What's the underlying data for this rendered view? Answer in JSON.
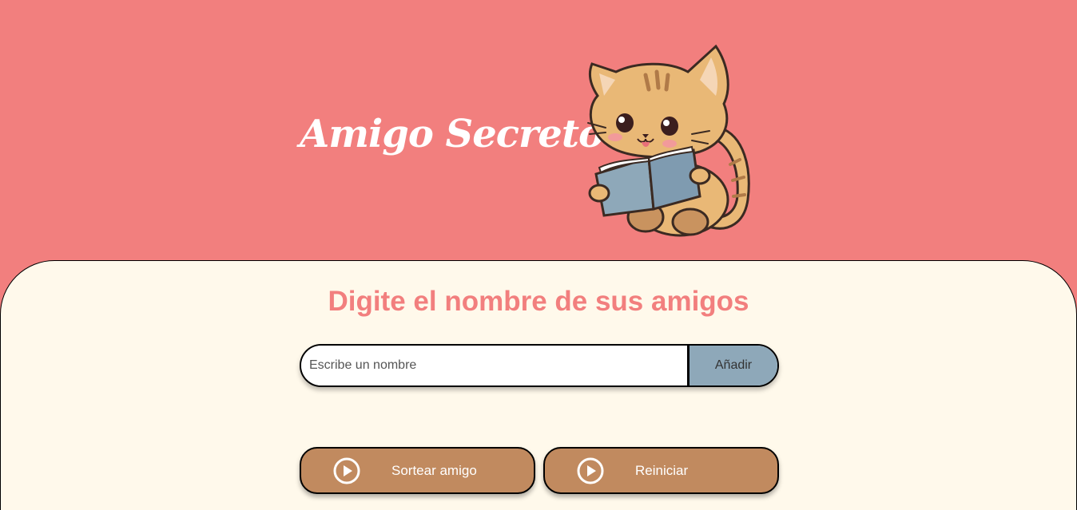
{
  "header": {
    "title": "Amigo Secreto",
    "mascot_icon": "cat-reading-book-icon"
  },
  "main": {
    "subtitle": "Digite el nombre de sus amigos",
    "name_input": {
      "value": "",
      "placeholder": "Escribe un nombre"
    },
    "add_button_label": "Añadir",
    "buttons": [
      {
        "label": "Sortear amigo",
        "icon": "play-circle-icon"
      },
      {
        "label": "Reiniciar",
        "icon": "play-circle-icon"
      }
    ]
  },
  "colors": {
    "background": "#f27f7e",
    "panel": "#fff9eb",
    "accent_text": "#f27f7e",
    "add_button": "#8ea8b9",
    "action_button": "#c18a5f"
  }
}
